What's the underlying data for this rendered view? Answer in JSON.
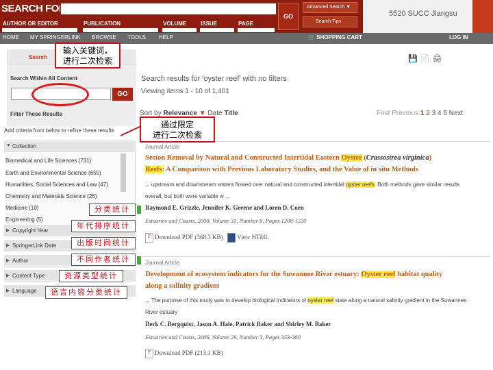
{
  "header": {
    "search_for": "SEARCH FOR",
    "author_label": "AUTHOR OR EDITOR",
    "publication_label": "PUBLICATION",
    "volume_label": "VOLUME",
    "issue_label": "ISSUE",
    "page_label": "PAGE",
    "go_label": "GO",
    "advanced_label": "Advanced Search",
    "tips_label": "Search Tips",
    "location": "5520 SUCC Jiangsu"
  },
  "nav": {
    "items": [
      "HOME",
      "MY SPRINGERLINK",
      "BROWSE",
      "TOOLS",
      "HELP"
    ],
    "cart": "SHOPPING CART",
    "login": "LOG IN"
  },
  "sidebar": {
    "search_label": "Search",
    "within_label": "Search Within All Content",
    "go_label": "GO",
    "filter_label": "Filter These Results",
    "hint": "Add criteria from below to refine these results",
    "collection_label": "Collection",
    "collection_items": [
      "Biomedical and Life Sciences (731)",
      "Earth and Environmental Science (655)",
      "Humanities, Social Sciences and Law (47)",
      "Chemistry and Materials Science (26)",
      "Medicine (10)",
      "Engineering (5)"
    ],
    "facets": [
      "Copyright Year",
      "SpringerLink Date",
      "Author",
      "Content Type",
      "Language"
    ]
  },
  "annotations": {
    "keyword_callout": [
      "输入关键词，",
      "进行二次检索"
    ],
    "limit_callout": [
      "通过限定",
      "进行二次检索"
    ],
    "stats": [
      "分类统计",
      "年代排序统计",
      "出版时间统计",
      "不同作者统计",
      "资源类型统计",
      "语言内容分类统计"
    ]
  },
  "main": {
    "results_title": "Search results for 'oyster reef' with no filters",
    "viewing": "Viewing items 1 - 10 of 1,401",
    "sort_by": "Sort by",
    "sort_relevance": "Relevance",
    "sort_date": "Date",
    "sort_title": "Title",
    "pager": {
      "first": "First",
      "previous": "Previous",
      "current": "1",
      "pages": [
        "2",
        "3",
        "4",
        "5"
      ],
      "next": "Next"
    },
    "articles": [
      {
        "type": "Journal Article",
        "title_a": "Seston Removal by Natural and Constructed Intertidal Eastern ",
        "title_hl": "Oyster",
        "title_b": " (",
        "title_i": "Crassostrea virginica",
        "title_c": ")",
        "title_line2_hl": "Reefs",
        "title_line2": ": A Comparison with Previous Laboratory Studies, and the Value of in situ Methods",
        "snippet_a": "... upstream and downstream waters flowed over natural and constructed intertidal ",
        "snippet_hl": "oyster reefs",
        "snippet_b": ". Both methods gave similar results",
        "snippet_line2": "overall, but both were variable w ...",
        "authors": "Raymond E. Grizzle, Jennifer K. Greene and Loren D. Coen",
        "journal": "Estuaries and Coasts, 2008, Volume 31, Number 6, Pages 1208-1220",
        "pdf": "Download PDF (368.3 KB)",
        "html": "View HTML"
      },
      {
        "type": "Journal Article",
        "title_a": "Development of ecosystem indicators for the Suwannee River estuary: ",
        "title_hl": "Oyster reef",
        "title_b": " habitat quality",
        "title_line2": "along a salinity gradient",
        "snippet_a": "... The purpose of this study was to develop biological indicators of ",
        "snippet_hl": "oyster reef",
        "snippet_b": " state along a natural salinity gradient in the Suwannee",
        "snippet_line2": "River estuary",
        "authors": "Derk C. Bergquist, Jason A. Hale, Patrick Baker and Shirley M. Baker",
        "journal": "Estuaries and Coasts, 2006, Volume 29, Number 3, Pages 353-360",
        "pdf": "Download PDF (213.1 KB)"
      }
    ]
  }
}
